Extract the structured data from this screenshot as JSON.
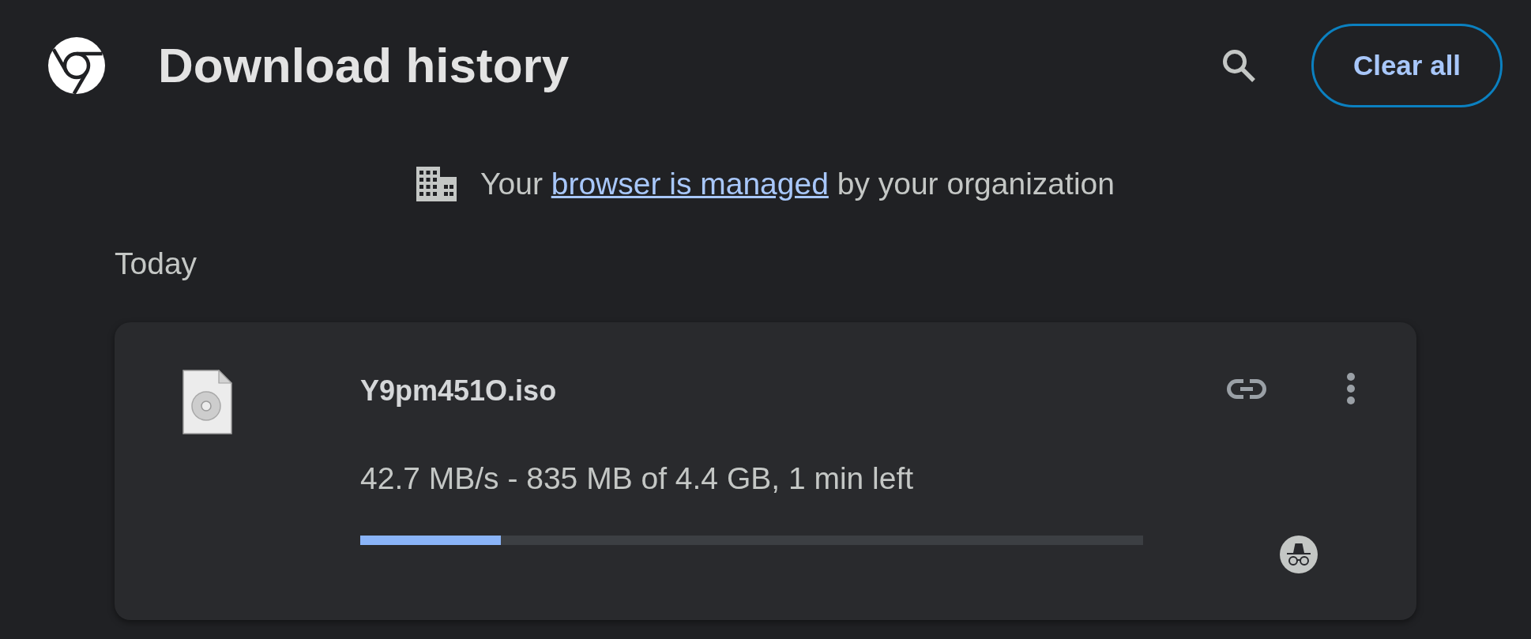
{
  "header": {
    "title": "Download history",
    "clear_button": "Clear all"
  },
  "notice": {
    "prefix": "Your ",
    "link": "browser is managed",
    "suffix": " by your organization"
  },
  "sections": [
    {
      "heading": "Today",
      "downloads": [
        {
          "filename": "Y9pm451O.iso",
          "status": "42.7 MB/s - 835 MB of 4.4 GB, 1 min left",
          "level": 0.18,
          "incognito": true
        }
      ]
    }
  ]
}
